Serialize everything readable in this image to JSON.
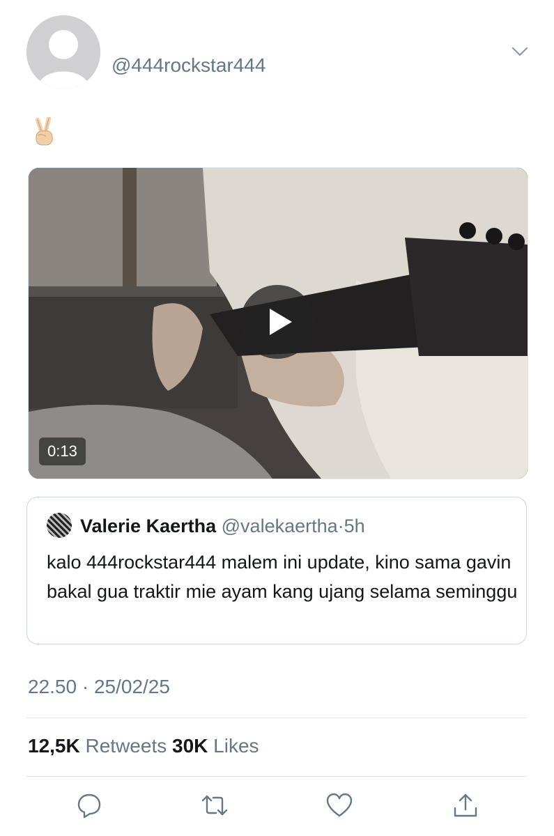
{
  "tweet": {
    "handle": "@444rockstar444",
    "text_emoji": "victory-hand-emoji",
    "video": {
      "duration": "0:13"
    },
    "quoted": {
      "name": "Valerie Kaertha",
      "handle": "@valekaertha",
      "separator": "·",
      "time": "5h",
      "text": "kalo 444rockstar444 malem ini update, kino sama gavin bakal gua traktir mie ayam kang ujang selama seminggu"
    },
    "timestamp": "22.50 · 25/02/25",
    "stats": {
      "retweets_count": "12,5K",
      "retweets_label": "Retweets",
      "likes_count": "30K",
      "likes_label": "Likes"
    }
  },
  "icons": [
    "chevron-down-icon",
    "play-icon",
    "reply-icon",
    "retweet-icon",
    "like-icon",
    "share-icon"
  ],
  "colors": {
    "muted": "#657786",
    "border": "#e1e8ed",
    "text": "#14171a"
  }
}
